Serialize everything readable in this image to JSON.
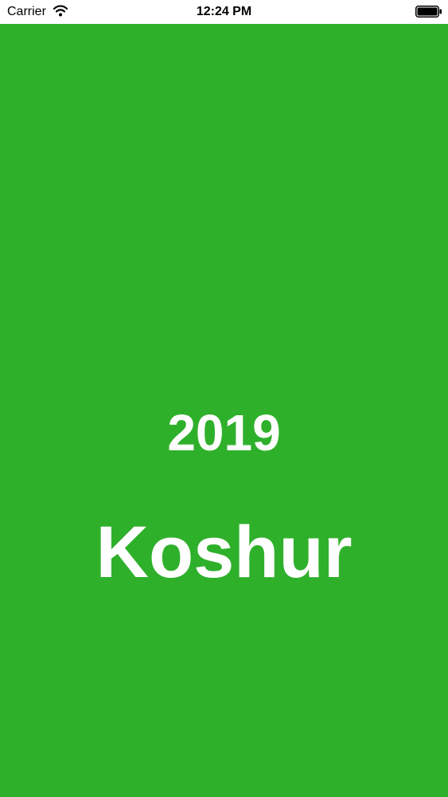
{
  "status_bar": {
    "carrier": "Carrier",
    "time": "12:24 PM",
    "wifi_icon": "wifi-icon",
    "battery_icon": "battery-full-icon"
  },
  "splash": {
    "year": "2019",
    "title": "Koshur"
  },
  "colors": {
    "background": "#2fb02b",
    "text": "#ffffff",
    "status_bar_background": "#ffffff"
  }
}
